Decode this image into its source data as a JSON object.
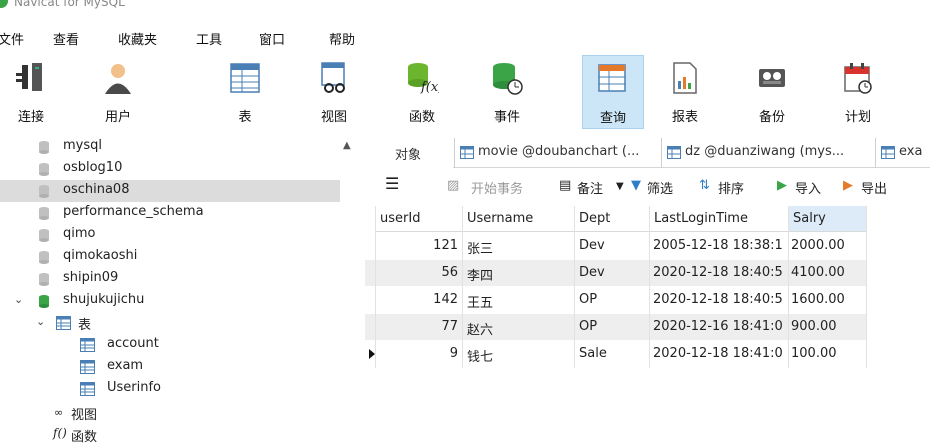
{
  "window": {
    "title": "Navicat for MySQL"
  },
  "menu": [
    "文件",
    "查看",
    "收藏夹",
    "工具",
    "窗口",
    "帮助"
  ],
  "toolbar": [
    {
      "label": "连接",
      "icon": "connection-icon"
    },
    {
      "label": "用户",
      "icon": "user-icon"
    },
    {
      "label": "表",
      "icon": "table-icon"
    },
    {
      "label": "视图",
      "icon": "view-icon"
    },
    {
      "label": "函数",
      "icon": "function-icon"
    },
    {
      "label": "事件",
      "icon": "event-icon"
    },
    {
      "label": "查询",
      "icon": "query-icon",
      "active": true
    },
    {
      "label": "报表",
      "icon": "report-icon"
    },
    {
      "label": "备份",
      "icon": "backup-icon"
    },
    {
      "label": "计划",
      "icon": "schedule-icon"
    }
  ],
  "tree": {
    "databases": [
      "mysql",
      "osblog10",
      "oschina08",
      "performance_schema",
      "qimo",
      "qimokaoshi",
      "shipin09",
      "shujukujichu"
    ],
    "selected": "oschina08",
    "open_db": "shujukujichu",
    "tables_label": "表",
    "tables": [
      "account",
      "exam",
      "Userinfo"
    ],
    "views_label": "视图",
    "functions_label": "函数"
  },
  "tabs": {
    "objects": "对象",
    "open": [
      "movie @doubanchart (...",
      "dz @duanziwang (mys...",
      "exa"
    ]
  },
  "data_toolbar": {
    "menu_icon": "hamburger-icon",
    "begin_tx": "开始事务",
    "memo": "备注",
    "filter": "筛选",
    "sort": "排序",
    "import": "导入",
    "export": "导出"
  },
  "grid": {
    "columns": [
      "userId",
      "Username",
      "Dept",
      "LastLoginTime",
      "Salry"
    ],
    "rows": [
      [
        "121",
        "张三",
        "Dev",
        "2005-12-18 18:38:1",
        "2000.00"
      ],
      [
        "56",
        "李四",
        "Dev",
        "2020-12-18 18:40:5",
        "4100.00"
      ],
      [
        "142",
        "王五",
        "OP",
        "2020-12-18 18:40:5",
        "1600.00"
      ],
      [
        "77",
        "赵六",
        "OP",
        "2020-12-16 18:41:0",
        "900.00"
      ],
      [
        "9",
        "钱七",
        "Sale",
        "2020-12-18 18:41:0",
        "100.00"
      ]
    ],
    "current_row": 4
  },
  "colors": {
    "accent": "#cde6f7",
    "selected_row": "#dcdcdc",
    "db_icon": "#c0c0c0",
    "open_db_icon": "#3aa447"
  }
}
